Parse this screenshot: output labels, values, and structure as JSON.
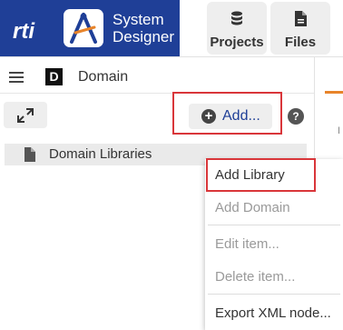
{
  "header": {
    "brand_text": "rti",
    "app_name_line1": "System",
    "app_name_line2": "Designer",
    "buttons": [
      {
        "label": "Projects",
        "icon": "database-icon"
      },
      {
        "label": "Files",
        "icon": "file-icon"
      }
    ]
  },
  "panel": {
    "icon_letter": "D",
    "title": "Domain"
  },
  "toolbar": {
    "add_label": "Add...",
    "help_label": "?"
  },
  "tree": {
    "items": [
      {
        "label": "Domain Libraries",
        "icon": "file-icon",
        "selected": true
      }
    ]
  },
  "context_menu": {
    "items": [
      {
        "label": "Add Library",
        "enabled": true
      },
      {
        "label": "Add Domain",
        "enabled": false
      },
      {
        "label": "Edit item...",
        "enabled": false
      },
      {
        "label": "Delete item...",
        "enabled": false
      },
      {
        "label": "Export XML node...",
        "enabled": true
      }
    ]
  },
  "colors": {
    "brand": "#1f3f97",
    "highlight": "#d9363a",
    "accent": "#e8842a"
  }
}
